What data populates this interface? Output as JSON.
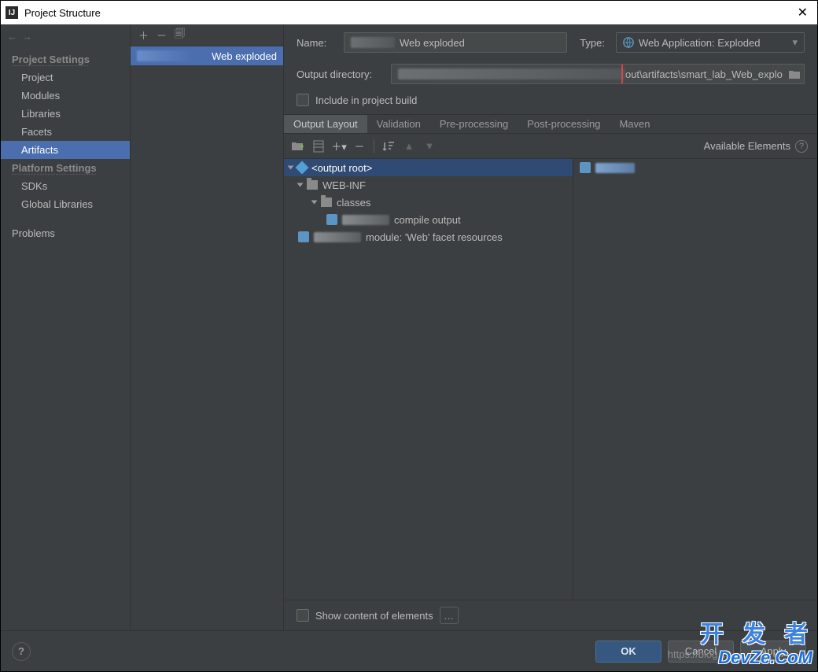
{
  "window": {
    "title": "Project Structure"
  },
  "sidebar": {
    "header1": "Project Settings",
    "items1": [
      "Project",
      "Modules",
      "Libraries",
      "Facets",
      "Artifacts"
    ],
    "header2": "Platform Settings",
    "items2": [
      "SDKs",
      "Global Libraries"
    ],
    "problems": "Problems"
  },
  "artifact_list": {
    "item": "Web exploded"
  },
  "main": {
    "name_label": "Name:",
    "name_value": "Web exploded",
    "type_label": "Type:",
    "type_value": "Web Application: Exploded",
    "outdir_label": "Output directory:",
    "outdir_suffix": "out\\artifacts\\smart_lab_Web_explo",
    "include_label": "Include in project build",
    "tabs": [
      "Output Layout",
      "Validation",
      "Pre-processing",
      "Post-processing",
      "Maven"
    ],
    "available_label": "Available Elements",
    "tree": {
      "root": "<output root>",
      "webinf": "WEB-INF",
      "classes": "classes",
      "compile": "compile output",
      "facet": "module: 'Web' facet resources"
    },
    "show_content": "Show content of elements"
  },
  "footer": {
    "ok": "OK",
    "cancel": "Cancel",
    "apply": "Apply"
  },
  "watermarks": {
    "cn": "开 发 者",
    "en": "DevZe.CoM",
    "url": "https://blog.cs"
  }
}
